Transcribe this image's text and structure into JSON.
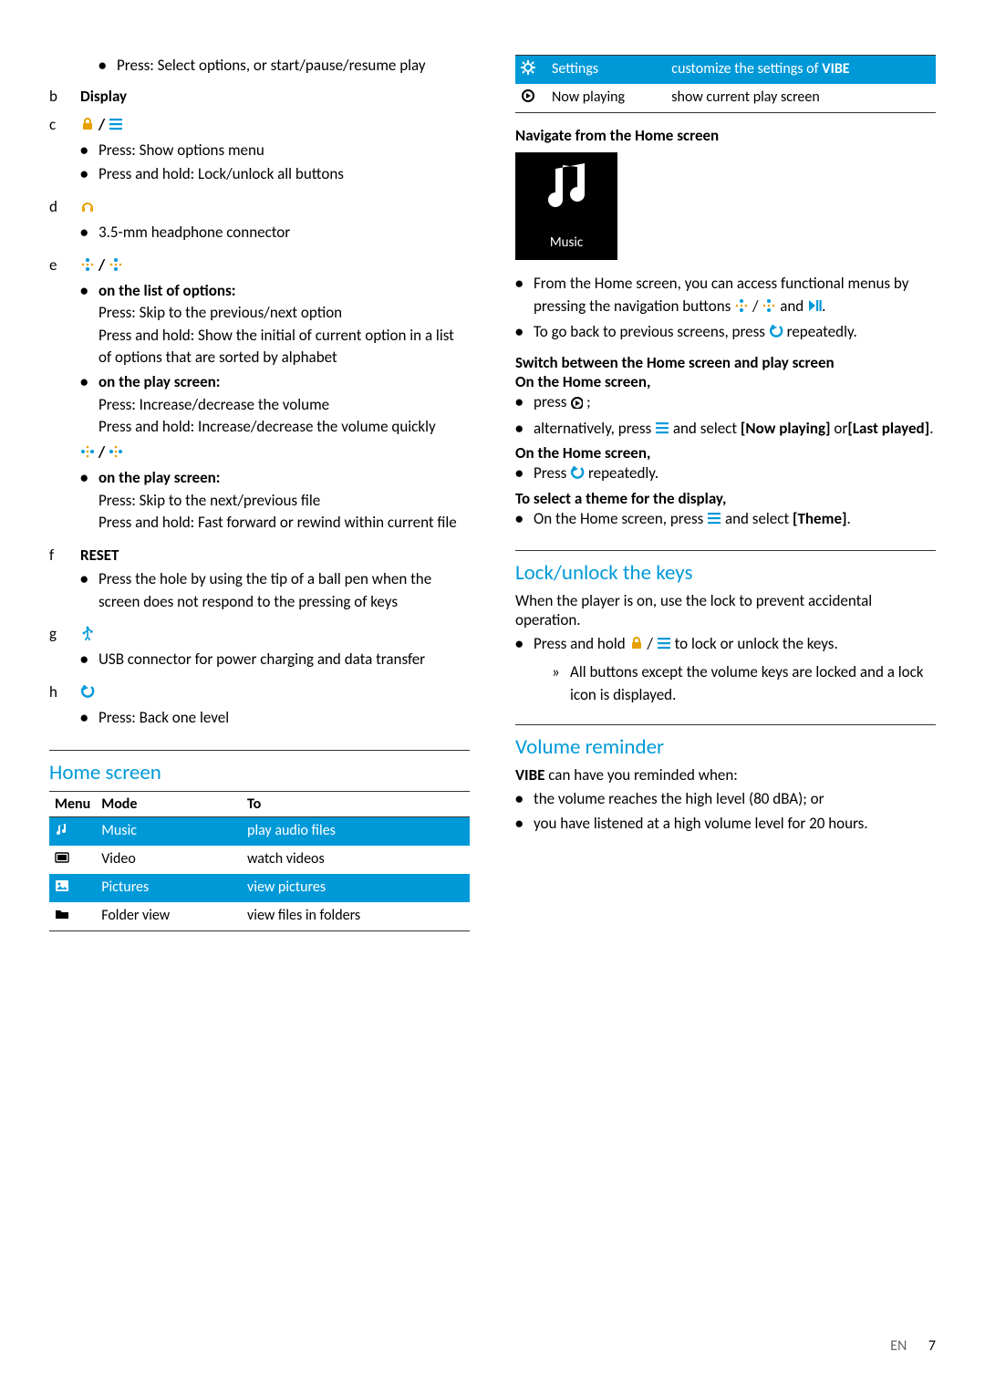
{
  "left": {
    "a_bullet": "Press: Select options, or start/pause/resume play",
    "b": {
      "letter": "b",
      "title": "Display"
    },
    "c": {
      "letter": "c",
      "b1": "Press: Show options menu",
      "b2": "Press and hold: Lock/unlock all buttons"
    },
    "d": {
      "letter": "d",
      "b1": "3.5-mm headphone connector"
    },
    "e": {
      "letter": "e",
      "h1": "on the list of options:",
      "t1a": "Press: Skip to the previous/next option",
      "t1b": "Press and hold: Show the initial of current option in a list of options that are sorted by alphabet",
      "h2": "on the play screen:",
      "t2a": "Press: Increase/decrease the volume",
      "t2b": "Press and hold: Increase/decrease the volume quickly",
      "h3": "on the play screen:",
      "t3a": "Press: Skip to the next/previous file",
      "t3b": "Press and hold: Fast forward or rewind within current file"
    },
    "f": {
      "letter": "f",
      "title": "RESET",
      "b1": "Press the hole by using the tip of a ball pen when the screen does not respond to the pressing of keys"
    },
    "g": {
      "letter": "g",
      "b1": "USB connector for power charging and data transfer"
    },
    "h": {
      "letter": "h",
      "b1": "Press: Back one level"
    },
    "home_screen": {
      "title": "Home screen",
      "headers": {
        "menu": "Menu",
        "mode": "Mode",
        "to": "To"
      },
      "rows": [
        {
          "mode": "Music",
          "to": "play audio files",
          "hl": true,
          "icon": "music"
        },
        {
          "mode": "Video",
          "to": "watch videos",
          "hl": false,
          "icon": "video"
        },
        {
          "mode": "Pictures",
          "to": "view pictures",
          "hl": true,
          "icon": "pictures"
        },
        {
          "mode": "Folder view",
          "to": "view files in folders",
          "hl": false,
          "icon": "folder"
        }
      ]
    }
  },
  "right": {
    "top_rows": [
      {
        "mode": "Settings",
        "to_a": "customize the settings of ",
        "to_b": "VIBE",
        "hl": true,
        "icon": "gear"
      },
      {
        "mode": "Now playing",
        "to": "show current play screen",
        "hl": false,
        "icon": "nowplay"
      }
    ],
    "nav_title": "Navigate from the Home screen",
    "music_tile": "Music",
    "nav_b1_a": "From the Home screen, you can access functional menus by pressing the navigation buttons ",
    "nav_b1_b": " and ",
    "nav_b1_c": ".",
    "nav_b2_a": "To go back to previous screens, press ",
    "nav_b2_b": " repeatedly.",
    "switch_title": "Switch between the Home screen and play screen",
    "on_home": "On the Home screen,",
    "home_b1_a": "press ",
    "home_b1_b": " ;",
    "home_b2_a": "alternatively, press ",
    "home_b2_b": " and select ",
    "home_b2_now": "[Now playing]",
    "home_b2_or": " or",
    "home_b2_last": "[Last played]",
    "home_b2_end": ".",
    "on_home2": "On the Home screen,",
    "home2_b1_a": "Press ",
    "home2_b1_b": " repeatedly.",
    "theme_title": "To select a theme for the display,",
    "theme_b1_a": "On the Home screen, press ",
    "theme_b1_b": " and select ",
    "theme_b1_c": "[Theme]",
    "theme_b1_d": ".",
    "lock_title": "Lock/unlock the keys",
    "lock_intro": "When the player is on, use the lock to prevent accidental operation.",
    "lock_b1_a": "Press and hold ",
    "lock_b1_b": " to lock or unlock the keys.",
    "lock_inner": "All buttons except the volume keys are locked and a lock icon is displayed.",
    "vol_title": "Volume reminder",
    "vol_intro_a": "VIBE",
    "vol_intro_b": " can have you reminded when:",
    "vol_b1": "the volume reaches the high level (80 dBA); or",
    "vol_b2": "you have listened at a high volume level for 20 hours."
  },
  "footer": {
    "lang": "EN",
    "page": "7"
  }
}
